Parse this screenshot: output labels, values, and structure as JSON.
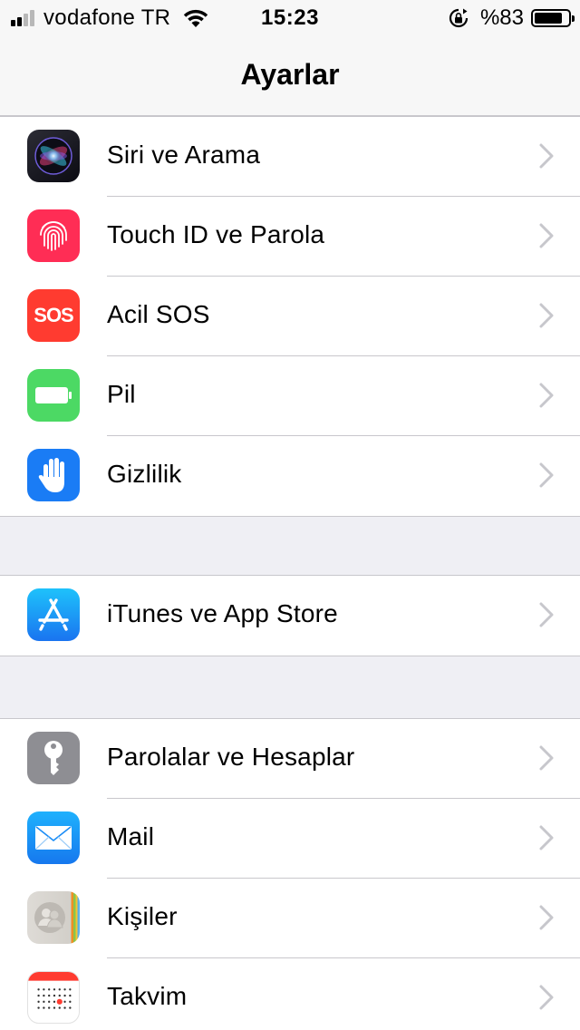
{
  "status_bar": {
    "carrier": "vodafone TR",
    "time": "15:23",
    "battery_percent": "%83",
    "battery_level": 0.83,
    "signal_bars": 2,
    "signal_total": 4
  },
  "nav": {
    "title": "Ayarlar"
  },
  "groups": [
    {
      "rows": [
        {
          "label": "Siri ve Arama",
          "icon": "siri-icon",
          "color": "#1c1c24"
        },
        {
          "label": "Touch ID ve Parola",
          "icon": "fingerprint-icon",
          "color": "#ff2d55"
        },
        {
          "label": "Acil SOS",
          "icon": "sos-icon",
          "icon_text": "SOS",
          "color": "#ff3b30"
        },
        {
          "label": "Pil",
          "icon": "battery-icon",
          "color": "#4cd964"
        },
        {
          "label": "Gizlilik",
          "icon": "hand-icon",
          "color": "#1a7cf5"
        }
      ]
    },
    {
      "rows": [
        {
          "label": "iTunes ve App Store",
          "icon": "app-store-icon",
          "color": "#1a8cf6"
        }
      ]
    },
    {
      "rows": [
        {
          "label": "Parolalar ve Hesaplar",
          "icon": "key-icon",
          "color": "#8e8e93"
        },
        {
          "label": "Mail",
          "icon": "mail-icon",
          "color": "#1a8cf6"
        },
        {
          "label": "Kişiler",
          "icon": "contacts-icon",
          "color": "#d6d3ce"
        },
        {
          "label": "Takvim",
          "icon": "calendar-icon",
          "color": "#ffffff"
        }
      ]
    }
  ],
  "colors": {
    "background": "#efeff4",
    "separator": "#c8c7cc",
    "chevron": "#c7c7cc"
  }
}
